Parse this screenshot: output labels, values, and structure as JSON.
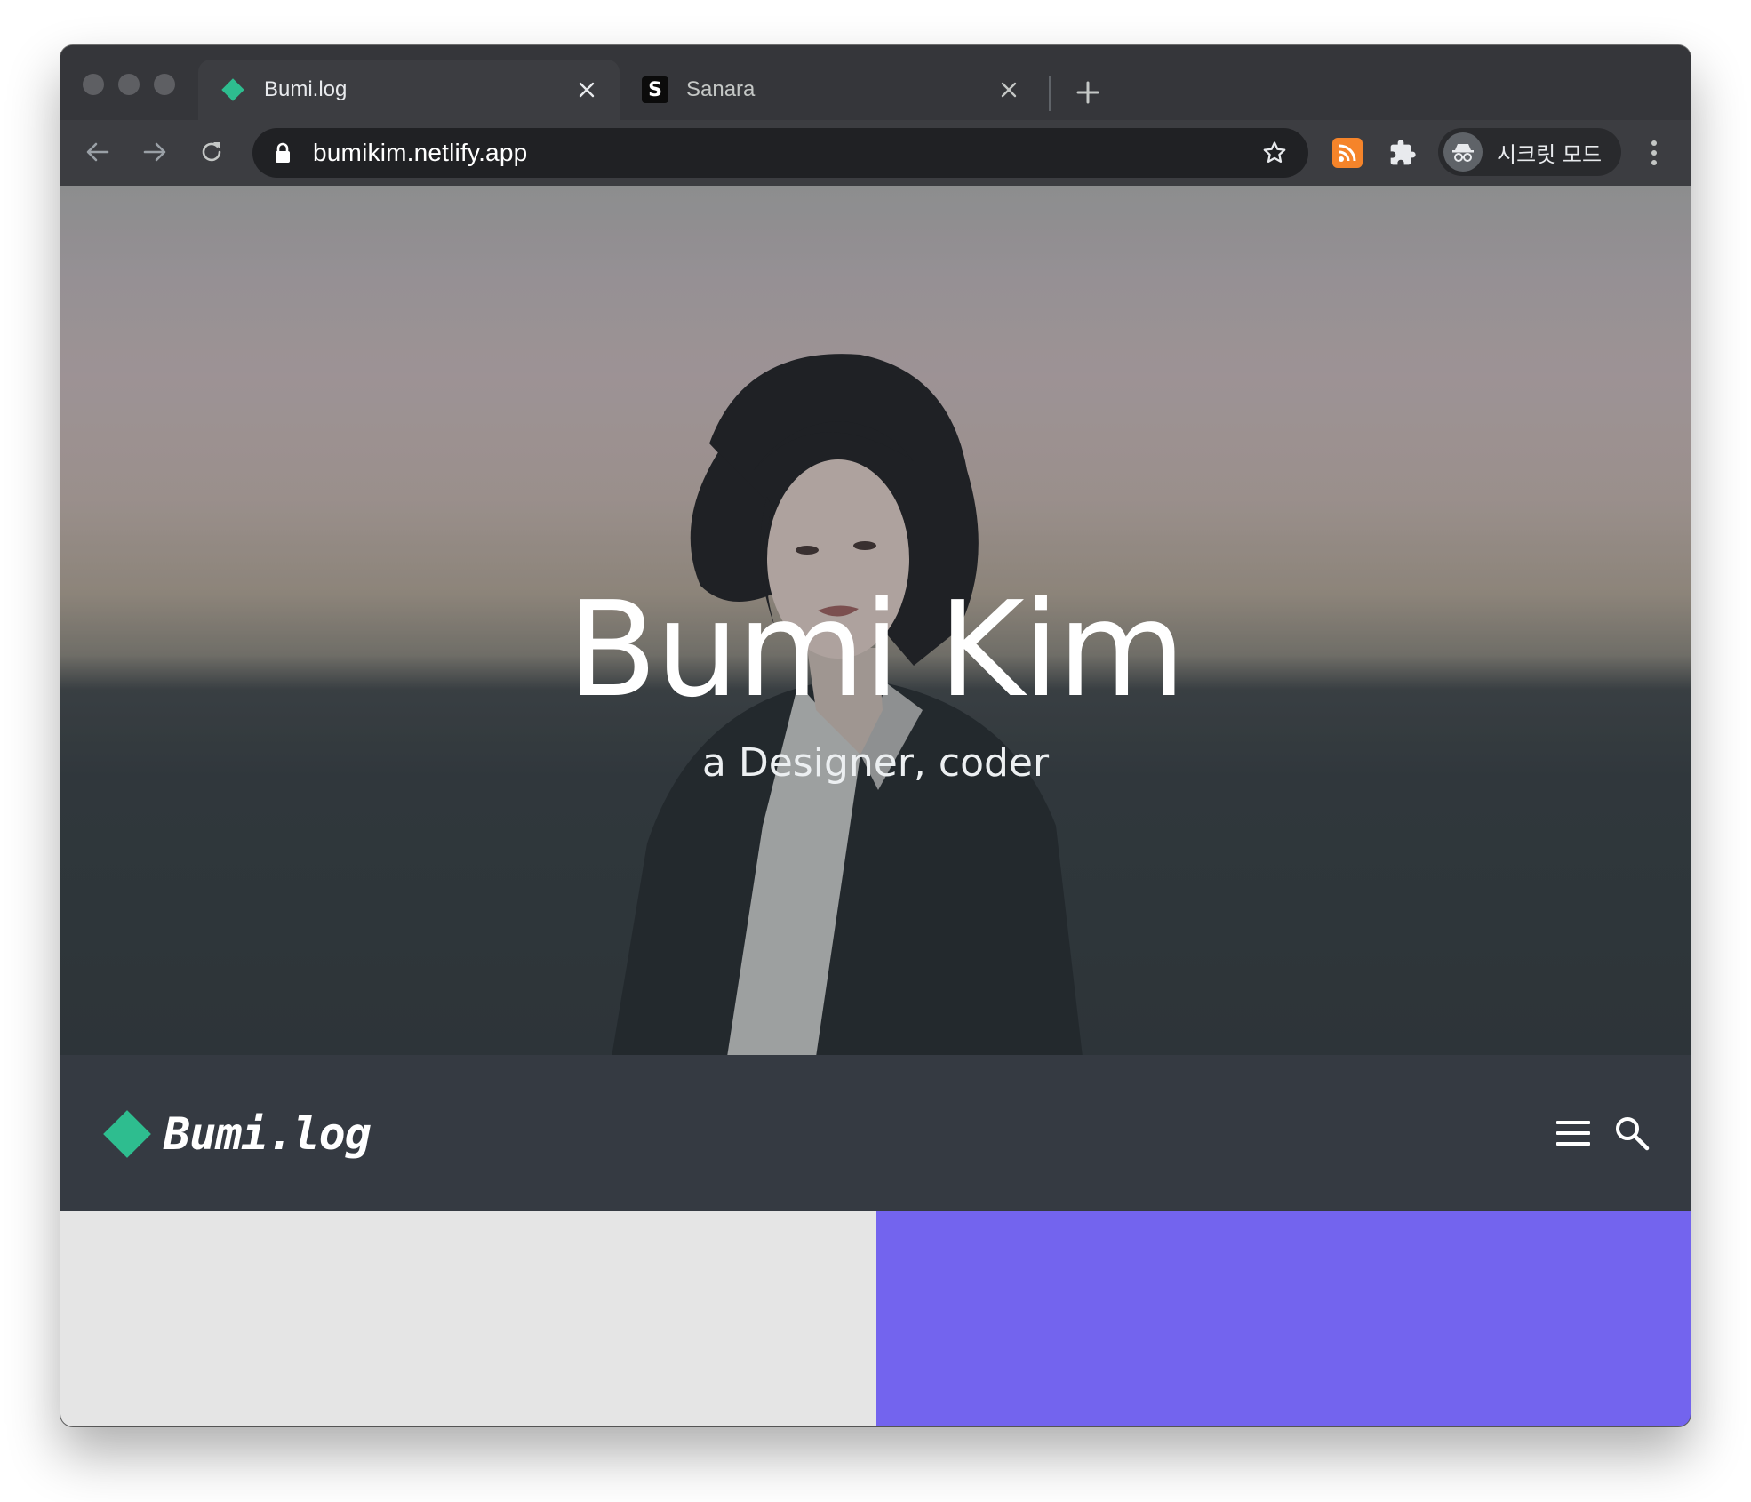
{
  "browser": {
    "tabs": [
      {
        "title": "Bumi.log",
        "active": true,
        "favicon": "green-diamond-icon"
      },
      {
        "title": "Sanara",
        "active": false,
        "favicon": "s-logo-icon",
        "favicon_letter": "S"
      }
    ],
    "address_bar": {
      "url": "bumikim.netlify.app",
      "secure": true
    },
    "profile": {
      "label": "시크릿 모드",
      "mode": "incognito"
    },
    "extensions": [
      "rss-icon",
      "puzzle-icon"
    ]
  },
  "page": {
    "hero": {
      "title": "Bumi Kim",
      "subtitle": "a Designer, coder"
    },
    "header": {
      "brand": "Bumi.log",
      "brand_color": "#2ebd8f"
    },
    "cards": [
      {
        "color": "#e5e5e5"
      },
      {
        "color": "#7364ee"
      }
    ]
  }
}
